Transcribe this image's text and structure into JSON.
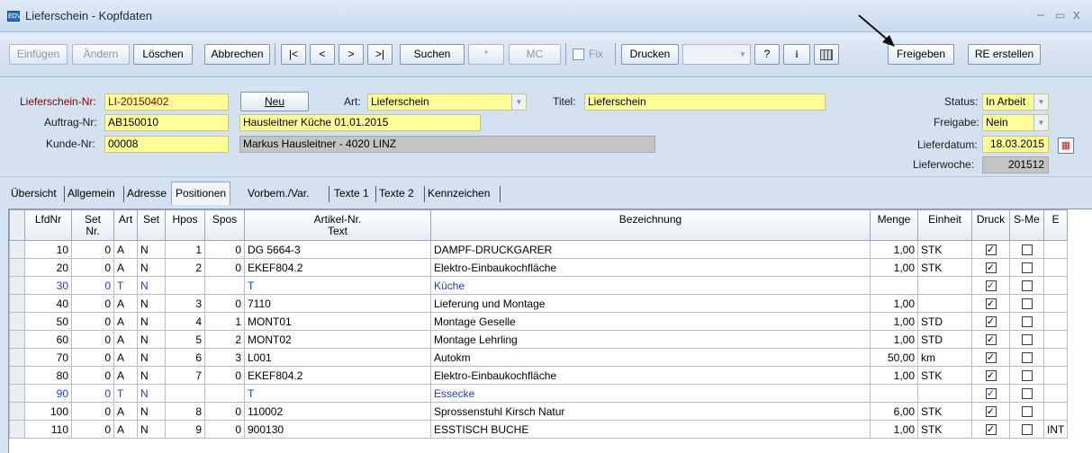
{
  "window": {
    "title": "Lieferschein - Kopfdaten",
    "app_icon": "EDV"
  },
  "toolbar": {
    "einfuegen": "Einfügen",
    "aendern": "Ändern",
    "loeschen": "Löschen",
    "abbrechen": "Abbrechen",
    "first": "|<",
    "prev": "<",
    "next": ">",
    "last": ">|",
    "suchen": "Suchen",
    "star": "*",
    "mc": "MC",
    "fix": "Fix",
    "drucken": "Drucken",
    "help": "?",
    "info": "i",
    "freigeben": "Freigeben",
    "re_erstellen": "RE erstellen"
  },
  "header": {
    "lieferschein_nr_label": "Lieferschein-Nr:",
    "lieferschein_nr": "LI-20150402",
    "auftrag_nr_label": "Auftrag-Nr:",
    "auftrag_nr": "AB150010",
    "kunde_nr_label": "Kunde-Nr:",
    "kunde_nr": "00008",
    "neu_button": "Neu",
    "art_label": "Art:",
    "art": "Lieferschein",
    "titel_label": "Titel:",
    "titel": "Lieferschein",
    "auftrag_text": "Hausleitner Küche 01.01.2015",
    "kunde_text": "Markus Hausleitner - 4020 LINZ",
    "status_label": "Status:",
    "status": "In Arbeit",
    "freigabe_label": "Freigabe:",
    "freigabe": "Nein",
    "lieferdatum_label": "Lieferdatum:",
    "lieferdatum": "18.03.2015",
    "lieferwoche_label": "Lieferwoche:",
    "lieferwoche": "201512"
  },
  "tabs": [
    "Übersicht",
    "Allgemein",
    "Adresse",
    "Positionen",
    "Vorbem./Var.",
    "Texte 1",
    "Texte 2",
    "Kennzeichen"
  ],
  "grid": {
    "columns": {
      "lfdnr": "LfdNr",
      "setnr_1": "Set",
      "setnr_2": "Nr.",
      "art": "Art",
      "set": "Set",
      "hpos": "Hpos",
      "spos": "Spos",
      "artikel_1": "Artikel-Nr.",
      "artikel_2": "Text",
      "bezeichnung": "Bezeichnung",
      "menge": "Menge",
      "einheit": "Einheit",
      "druck": "Druck",
      "sme": "S-Me",
      "extra": "E"
    },
    "rows": [
      {
        "lfd": "10",
        "setnr": "0",
        "art": "A",
        "set": "N",
        "hpos": "1",
        "spos": "0",
        "artikel": "DG 5664-3",
        "bez": "DAMPF-DRUCKGARER",
        "menge": "1,00",
        "einheit": "STK",
        "druck": true,
        "sme": false,
        "extra": "",
        "blue": false
      },
      {
        "lfd": "20",
        "setnr": "0",
        "art": "A",
        "set": "N",
        "hpos": "2",
        "spos": "0",
        "artikel": "EKEF804.2",
        "bez": "Elektro-Einbaukochfläche",
        "menge": "1,00",
        "einheit": "STK",
        "druck": true,
        "sme": false,
        "extra": "",
        "blue": false
      },
      {
        "lfd": "30",
        "setnr": "0",
        "art": "T",
        "set": "N",
        "hpos": "",
        "spos": "",
        "artikel": "T",
        "bez": "Küche",
        "menge": "",
        "einheit": "",
        "druck": true,
        "sme": false,
        "extra": "",
        "blue": true
      },
      {
        "lfd": "40",
        "setnr": "0",
        "art": "A",
        "set": "N",
        "hpos": "3",
        "spos": "0",
        "artikel": "7110",
        "bez": "Lieferung und Montage",
        "menge": "1,00",
        "einheit": "",
        "druck": true,
        "sme": false,
        "extra": "",
        "blue": false
      },
      {
        "lfd": "50",
        "setnr": "0",
        "art": "A",
        "set": "N",
        "hpos": "4",
        "spos": "1",
        "artikel": "MONT01",
        "bez": "Montage Geselle",
        "menge": "1,00",
        "einheit": "STD",
        "druck": true,
        "sme": false,
        "extra": "",
        "blue": false
      },
      {
        "lfd": "60",
        "setnr": "0",
        "art": "A",
        "set": "N",
        "hpos": "5",
        "spos": "2",
        "artikel": "MONT02",
        "bez": "Montage Lehrling",
        "menge": "1,00",
        "einheit": "STD",
        "druck": true,
        "sme": false,
        "extra": "",
        "blue": false
      },
      {
        "lfd": "70",
        "setnr": "0",
        "art": "A",
        "set": "N",
        "hpos": "6",
        "spos": "3",
        "artikel": "L001",
        "bez": "Autokm",
        "menge": "50,00",
        "einheit": "km",
        "druck": true,
        "sme": false,
        "extra": "",
        "blue": false
      },
      {
        "lfd": "80",
        "setnr": "0",
        "art": "A",
        "set": "N",
        "hpos": "7",
        "spos": "0",
        "artikel": "EKEF804.2",
        "bez": "Elektro-Einbaukochfläche",
        "menge": "1,00",
        "einheit": "STK",
        "druck": true,
        "sme": false,
        "extra": "",
        "blue": false
      },
      {
        "lfd": "90",
        "setnr": "0",
        "art": "T",
        "set": "N",
        "hpos": "",
        "spos": "",
        "artikel": "T",
        "bez": "Essecke",
        "menge": "",
        "einheit": "",
        "druck": true,
        "sme": false,
        "extra": "",
        "blue": true
      },
      {
        "lfd": "100",
        "setnr": "0",
        "art": "A",
        "set": "N",
        "hpos": "8",
        "spos": "0",
        "artikel": "110002",
        "bez": "Sprossenstuhl Kirsch Natur",
        "menge": "6,00",
        "einheit": "STK",
        "druck": true,
        "sme": false,
        "extra": "",
        "blue": false
      },
      {
        "lfd": "110",
        "setnr": "0",
        "art": "A",
        "set": "N",
        "hpos": "9",
        "spos": "0",
        "artikel": "900130",
        "bez": "ESSTISCH BUCHE",
        "menge": "1,00",
        "einheit": "STK",
        "druck": true,
        "sme": false,
        "extra": "INT",
        "blue": false
      }
    ]
  }
}
